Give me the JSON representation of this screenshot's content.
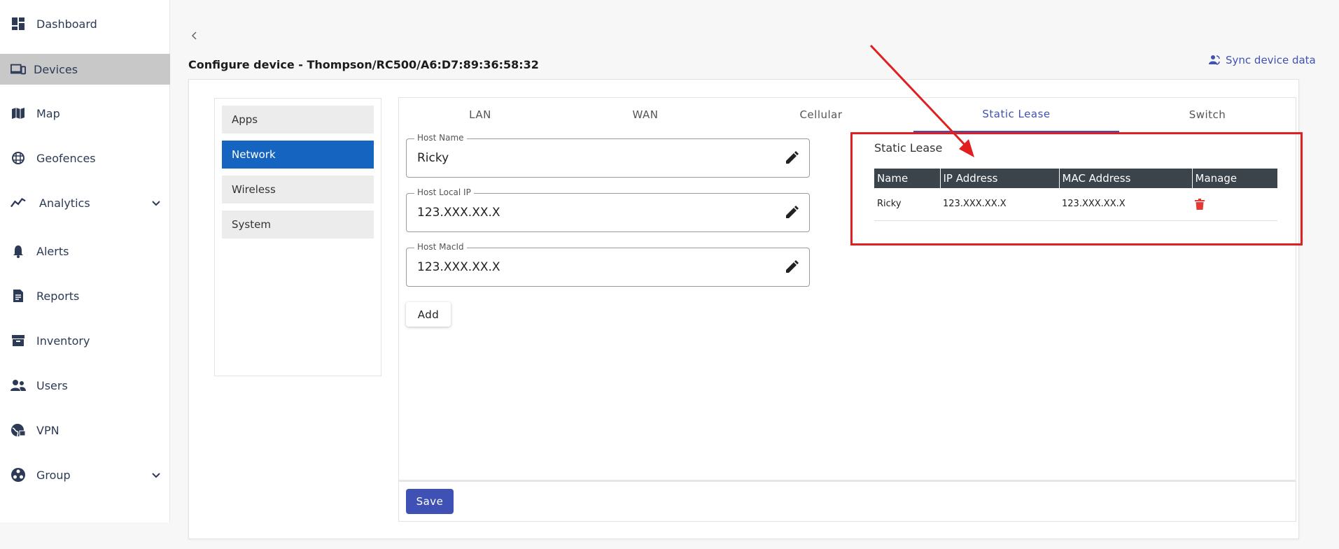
{
  "sidebar": {
    "items": [
      {
        "label": "Dashboard",
        "icon": "dashboard-icon"
      },
      {
        "label": "Devices",
        "icon": "devices-icon",
        "active": true
      },
      {
        "label": "Map",
        "icon": "map-icon"
      },
      {
        "label": "Geofences",
        "icon": "geofence-icon"
      },
      {
        "label": "Analytics",
        "icon": "analytics-icon",
        "expandable": true
      },
      {
        "label": "Alerts",
        "icon": "bell-icon"
      },
      {
        "label": "Reports",
        "icon": "report-icon"
      },
      {
        "label": "Inventory",
        "icon": "inventory-icon"
      },
      {
        "label": "Users",
        "icon": "users-icon"
      },
      {
        "label": "VPN",
        "icon": "vpn-icon"
      },
      {
        "label": "Group",
        "icon": "group-icon",
        "expandable": true
      }
    ]
  },
  "header": {
    "title": "Configure device - Thompson/RC500/A6:D7:89:36:58:32",
    "sync_label": "Sync device data"
  },
  "menu": {
    "items": [
      {
        "label": "Apps"
      },
      {
        "label": "Network",
        "active": true
      },
      {
        "label": "Wireless"
      },
      {
        "label": "System"
      }
    ]
  },
  "tabs": [
    {
      "label": "LAN"
    },
    {
      "label": "WAN"
    },
    {
      "label": "Cellular"
    },
    {
      "label": "Static Lease",
      "active": true
    },
    {
      "label": "Switch"
    }
  ],
  "form": {
    "host_name": {
      "label": "Host Name",
      "value": "Ricky"
    },
    "host_ip": {
      "label": "Host Local IP",
      "value": "123.XXX.XX.X"
    },
    "host_mac": {
      "label": "Host MacId",
      "value": "123.XXX.XX.X"
    },
    "add_label": "Add",
    "save_label": "Save"
  },
  "static_lease": {
    "title": "Static Lease",
    "columns": [
      "Name",
      "IP Address",
      "MAC Address",
      "Manage"
    ],
    "rows": [
      {
        "name": "Ricky",
        "ip": "123.XXX.XX.X",
        "mac": "123.XXX.XX.X"
      }
    ]
  },
  "colors": {
    "accent": "#3f51b5",
    "active_menu": "#1565c0",
    "table_header": "#3b444b",
    "annotation": "#e02020",
    "delete": "#e53935"
  }
}
